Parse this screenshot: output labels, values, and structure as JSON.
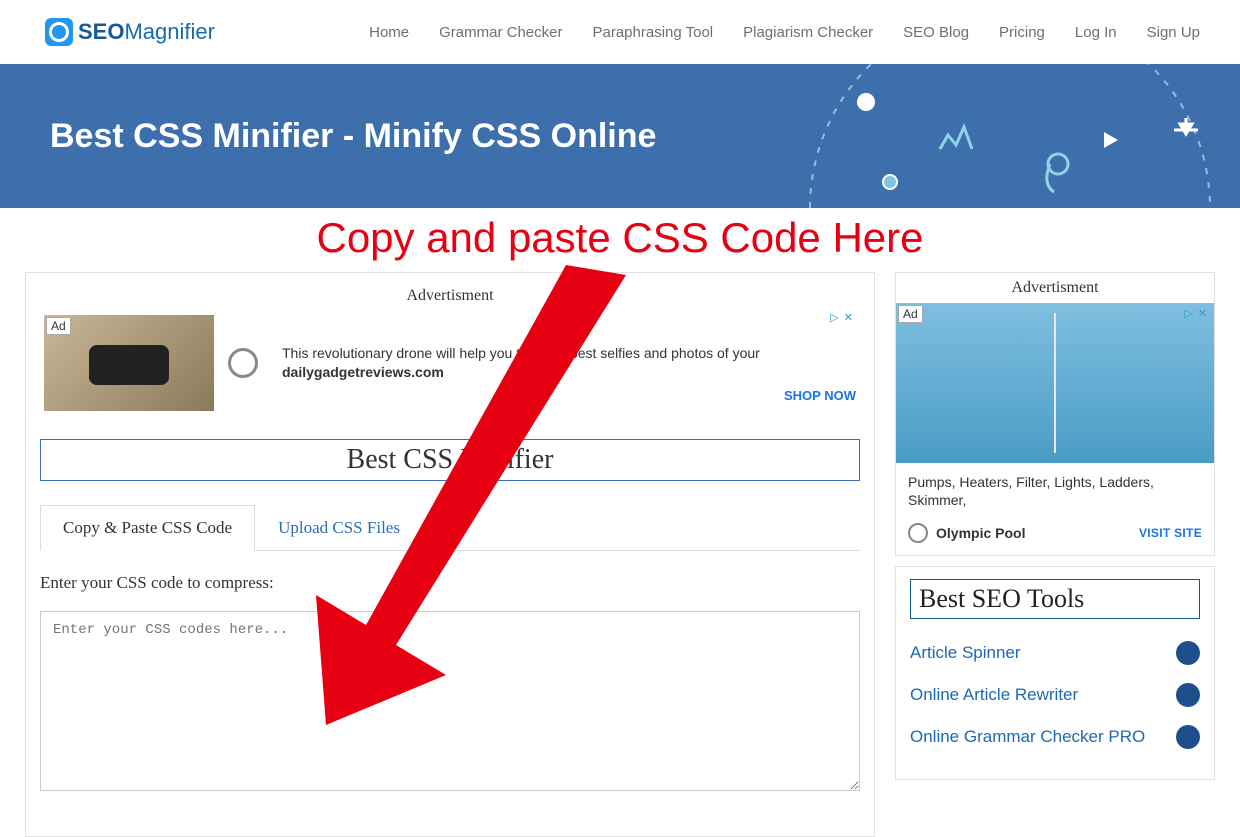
{
  "logo": {
    "seo": "SEO",
    "mag": "Magnifier"
  },
  "nav": [
    "Home",
    "Grammar Checker",
    "Paraphrasing Tool",
    "Plagiarism Checker",
    "SEO Blog",
    "Pricing",
    "Log In",
    "Sign Up"
  ],
  "hero_title": "Best CSS Minifier - Minify CSS Online",
  "annotation": "Copy and paste CSS Code Here",
  "ad_label": "Advertisment",
  "ad1": {
    "badge": "Ad",
    "text": "This revolutionary drone will help you take the best selfies and photos of your",
    "domain": "dailygadgetreviews.com",
    "cta": "SHOP NOW",
    "close": "▷ ✕"
  },
  "tool_title": "Best CSS Minifier",
  "tabs": {
    "t1": "Copy & Paste CSS Code",
    "t2": "Upload CSS Files"
  },
  "input_label": "Enter your CSS code to compress:",
  "input_placeholder": "Enter your CSS codes here...",
  "ad2": {
    "badge": "Ad",
    "desc": "Pumps, Heaters, Filter, Lights, Ladders, Skimmer,",
    "name": "Olympic Pool",
    "cta": "VISIT SITE",
    "close": "▷ ✕"
  },
  "sidebar": {
    "title": "Best SEO Tools",
    "links": [
      "Article Spinner",
      "Online Article Rewriter",
      "Online Grammar Checker PRO"
    ]
  }
}
